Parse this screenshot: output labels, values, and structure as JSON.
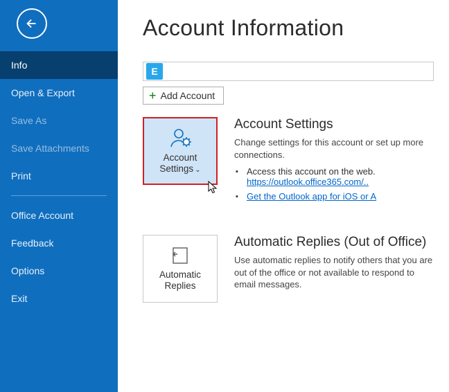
{
  "sidebar": {
    "items": [
      {
        "label": "Info",
        "active": true
      },
      {
        "label": "Open & Export"
      },
      {
        "label": "Save As",
        "dim": true
      },
      {
        "label": "Save Attachments",
        "dim": true
      },
      {
        "label": "Print"
      }
    ],
    "lower": [
      {
        "label": "Office Account"
      },
      {
        "label": "Feedback"
      },
      {
        "label": "Options"
      },
      {
        "label": "Exit"
      }
    ]
  },
  "page_title": "Account Information",
  "add_account_label": "Add Account",
  "account_settings": {
    "tile_label": "Account Settings",
    "heading": "Account Settings",
    "desc": "Change settings for this account or set up more connections.",
    "bullet1_text": "Access this account on the web.",
    "bullet1_link": "https://outlook.office365.com/..",
    "bullet2_link": "Get the Outlook app for iOS or A"
  },
  "auto_replies": {
    "tile_label": "Automatic Replies",
    "heading": "Automatic Replies (Out of Office)",
    "desc": "Use automatic replies to notify others that you are out of the office or not available to respond to email messages."
  }
}
